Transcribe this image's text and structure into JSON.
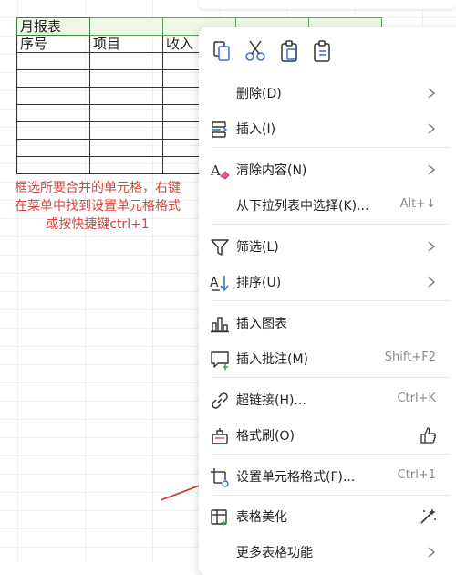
{
  "sheet": {
    "title": "月报表",
    "headers": [
      "序号",
      "项目",
      "收入"
    ]
  },
  "note": {
    "line1": "框选所要合并的单元格，右键",
    "line2": "在菜单中找到设置单元格格式",
    "line3": "或按快捷键ctrl+1"
  },
  "menu": {
    "quick_icons": [
      "copy-icon",
      "cut-icon",
      "paste-icon",
      "paste-special-icon"
    ],
    "items": [
      {
        "label": "删除(D)",
        "icon": "",
        "submenu": true
      },
      {
        "label": "插入(I)",
        "icon": "insert-icon",
        "submenu": true
      },
      {
        "label": "清除内容(N)",
        "icon": "eraser-icon",
        "submenu": true
      },
      {
        "label": "从下拉列表中选择(K)...",
        "icon": "",
        "shortcut": "Alt+↓"
      },
      {
        "label": "筛选(L)",
        "icon": "filter-icon",
        "submenu": true
      },
      {
        "label": "排序(U)",
        "icon": "sort-icon",
        "submenu": true
      },
      {
        "label": "插入图表",
        "icon": "chart-icon"
      },
      {
        "label": "插入批注(M)",
        "icon": "comment-icon",
        "shortcut": "Shift+F2"
      },
      {
        "label": "超链接(H)...",
        "icon": "link-icon",
        "shortcut": "Ctrl+K"
      },
      {
        "label": "格式刷(O)",
        "icon": "format-brush-icon"
      },
      {
        "label": "设置单元格格式(F)...",
        "icon": "cell-format-icon",
        "shortcut": "Ctrl+1"
      },
      {
        "label": "表格美化",
        "icon": "table-beautify-icon"
      },
      {
        "label": "更多表格功能",
        "icon": "",
        "submenu": true
      }
    ]
  },
  "colors": {
    "annotation": "#d9463c",
    "accent_green": "#3c8a3c",
    "icon_blue": "#3d6fd6"
  }
}
